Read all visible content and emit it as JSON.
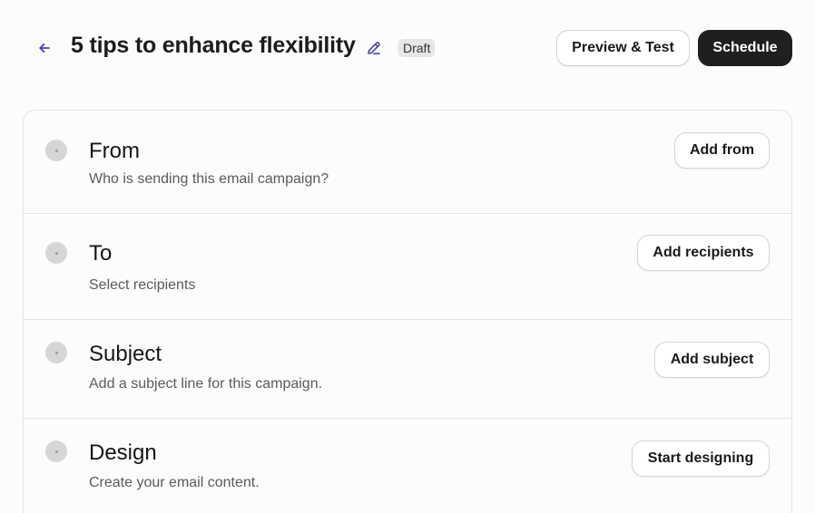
{
  "header": {
    "title": "5 tips to enhance flexibility",
    "status_badge": "Draft",
    "preview_label": "Preview & Test",
    "schedule_label": "Schedule"
  },
  "icons": {
    "back": "arrow-left-icon",
    "edit": "pencil-icon",
    "status": "circle-status-icon"
  },
  "colors": {
    "accent": "#4a44a8",
    "primary_button": "#1f1f1f",
    "badge_bg": "#e6e6e6",
    "status_dot": "#d6d6d6"
  },
  "sections": [
    {
      "title": "From",
      "description": "Who is sending this email campaign?",
      "action_label": "Add from"
    },
    {
      "title": "To",
      "description": "Select recipients",
      "action_label": "Add recipients"
    },
    {
      "title": "Subject",
      "description": "Add a subject line for this campaign.",
      "action_label": "Add subject"
    },
    {
      "title": "Design",
      "description": "Create your email content.",
      "action_label": "Start designing"
    }
  ]
}
